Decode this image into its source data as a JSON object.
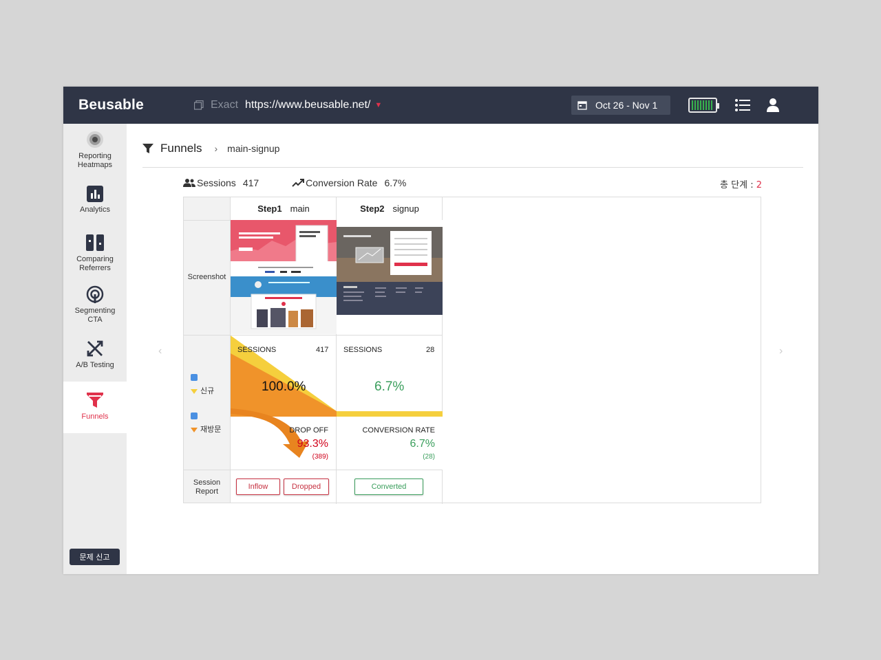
{
  "app": {
    "logo": "Beusable"
  },
  "topbar": {
    "match_type": "Exact",
    "url": "https://www.beusable.net/",
    "date_range": "Oct 26 - Nov 1"
  },
  "sidebar": {
    "items": [
      {
        "label_1": "Reporting",
        "label_2": "Heatmaps"
      },
      {
        "label_1": "Analytics",
        "label_2": ""
      },
      {
        "label_1": "Comparing",
        "label_2": "Referrers"
      },
      {
        "label_1": "Segmenting",
        "label_2": "CTA"
      },
      {
        "label_1": "A/B Testing",
        "label_2": ""
      },
      {
        "label_1": "Funnels",
        "label_2": ""
      }
    ],
    "report_button": "문제 신고"
  },
  "breadcrumb": {
    "title": "Funnels",
    "sub": "main-signup"
  },
  "stats": {
    "sessions_label": "Sessions",
    "sessions_value": "417",
    "conversion_label": "Conversion Rate",
    "conversion_value": "6.7%",
    "total_label": "총 단계 : ",
    "total_value": "2"
  },
  "funnel": {
    "row_labels": {
      "screenshot": "Screenshot",
      "session_report_1": "Session",
      "session_report_2": "Report"
    },
    "legend": [
      {
        "label": "신규",
        "color": "#f5cf3d"
      },
      {
        "label": "재방문",
        "color": "#f0932a"
      }
    ],
    "steps": [
      {
        "step": "Step1",
        "name": "main",
        "sessions_label": "SESSIONS",
        "sessions": "417",
        "pct": "100.0%",
        "bottom_label": "DROP OFF",
        "bottom_pct": "93.3%",
        "bottom_count": "(389)",
        "buttons": [
          "Inflow",
          "Dropped"
        ]
      },
      {
        "step": "Step2",
        "name": "signup",
        "sessions_label": "SESSIONS",
        "sessions": "28",
        "pct": "6.7%",
        "bottom_label": "CONVERSION RATE",
        "bottom_pct": "6.7%",
        "bottom_count": "(28)",
        "buttons": [
          "Converted"
        ]
      }
    ],
    "chart_data": {
      "type": "area",
      "categories": [
        "Step1",
        "Step2"
      ],
      "series": [
        {
          "name": "신규",
          "values": [
            417,
            28
          ]
        },
        {
          "name": "재방문",
          "values": [
            0,
            0
          ]
        }
      ]
    }
  },
  "colors": {
    "accent": "#e0314b",
    "green": "#3a9e5c",
    "topbar": "#2f3546",
    "drop": "#d0021b"
  },
  "nav_arrows": {
    "left": "‹",
    "right": "›"
  }
}
